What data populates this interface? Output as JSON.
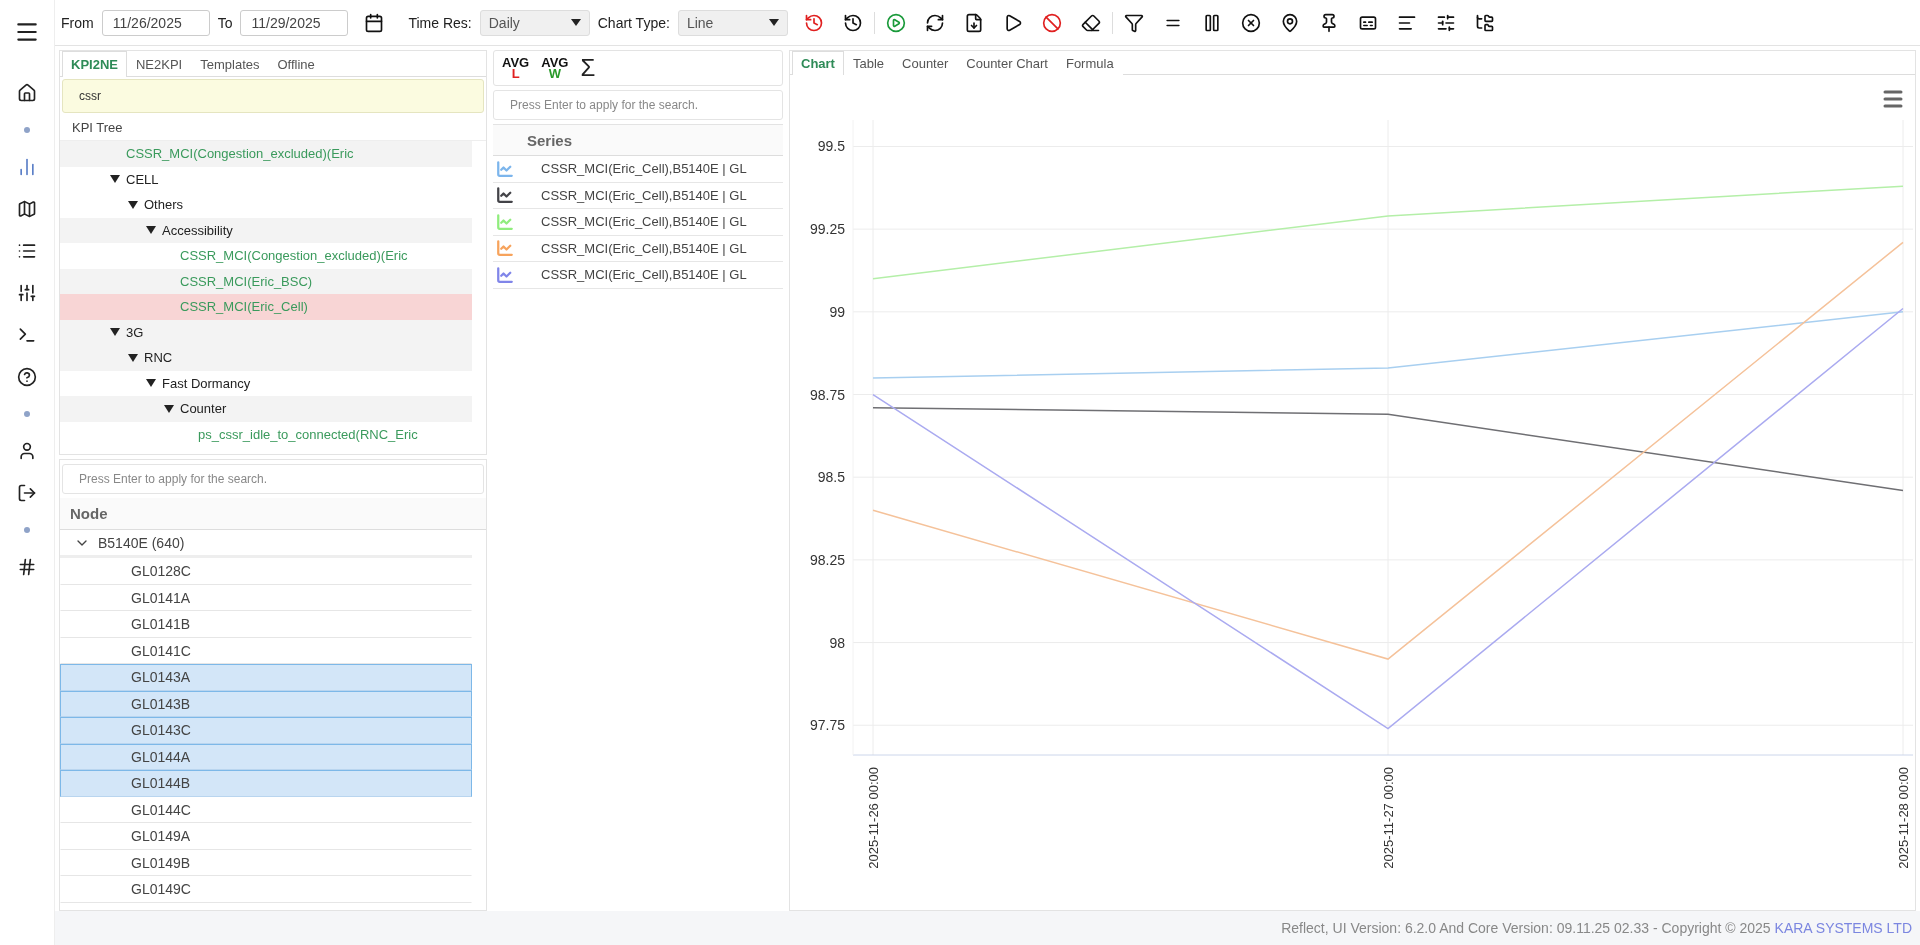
{
  "toolbar": {
    "from_label": "From",
    "from_value": "11/26/2025",
    "to_label": "To",
    "to_value": "11/29/2025",
    "time_res_label": "Time Res:",
    "time_res_value": "Daily",
    "chart_type_label": "Chart Type:",
    "chart_type_value": "Line"
  },
  "left_tabs": [
    {
      "label": "KPI2NE",
      "selected": true
    },
    {
      "label": "NE2KPI",
      "selected": false
    },
    {
      "label": "Templates",
      "selected": false
    },
    {
      "label": "Offline",
      "selected": false
    }
  ],
  "kpi_search": {
    "value": "cssr"
  },
  "kpi_tree": {
    "header": "KPI Tree",
    "items": [
      {
        "label": "CSSR_MCI(Congestion_excluded)(Eric",
        "kind": "kpi",
        "selected": false
      },
      {
        "label": "CELL",
        "kind": "folder",
        "expanded": true,
        "children": [
          {
            "label": "Others",
            "kind": "folder",
            "expanded": true,
            "children": [
              {
                "label": "Accessibility",
                "kind": "folder",
                "expanded": true,
                "children": [
                  {
                    "label": "CSSR_MCI(Congestion_excluded)(Eric",
                    "kind": "kpi",
                    "selected": false
                  },
                  {
                    "label": "CSSR_MCI(Eric_BSC)",
                    "kind": "kpi",
                    "selected": false
                  },
                  {
                    "label": "CSSR_MCI(Eric_Cell)",
                    "kind": "kpi",
                    "selected": true
                  }
                ]
              }
            ]
          }
        ]
      },
      {
        "label": "3G",
        "kind": "folder",
        "expanded": true,
        "children": [
          {
            "label": "RNC",
            "kind": "folder",
            "expanded": true,
            "children": [
              {
                "label": "Fast Dormancy",
                "kind": "folder",
                "expanded": true,
                "children": [
                  {
                    "label": "Counter",
                    "kind": "folder",
                    "expanded": true,
                    "children": [
                      {
                        "label": "ps_cssr_idle_to_connected(RNC_Eric",
                        "kind": "kpi",
                        "selected": false
                      }
                    ]
                  }
                ]
              }
            ]
          }
        ]
      }
    ]
  },
  "node_search": {
    "placeholder": "Press Enter to apply for the search."
  },
  "node_table": {
    "header": "Node",
    "group": {
      "label": "B5140E (640)",
      "expanded": true
    },
    "rows": [
      {
        "label": "GL0128C",
        "selected": false
      },
      {
        "label": "GL0141A",
        "selected": false
      },
      {
        "label": "GL0141B",
        "selected": false
      },
      {
        "label": "GL0141C",
        "selected": false
      },
      {
        "label": "GL0143A",
        "selected": true
      },
      {
        "label": "GL0143B",
        "selected": true
      },
      {
        "label": "GL0143C",
        "selected": true
      },
      {
        "label": "GL0144A",
        "selected": true
      },
      {
        "label": "GL0144B",
        "selected": true
      },
      {
        "label": "GL0144C",
        "selected": false
      },
      {
        "label": "GL0149A",
        "selected": false
      },
      {
        "label": "GL0149B",
        "selected": false
      },
      {
        "label": "GL0149C",
        "selected": false
      }
    ]
  },
  "aggregate_buttons": [
    {
      "label": "AVG",
      "sub": "L",
      "color": "#e02020"
    },
    {
      "label": "AVG",
      "sub": "W",
      "color": "#2a9a2a"
    },
    {
      "label": "Σ"
    }
  ],
  "series_search": {
    "placeholder": "Press Enter to apply for the search."
  },
  "series_list": {
    "header": "Series",
    "rows": [
      {
        "label": "CSSR_MCI(Eric_Cell),B5140E | GL",
        "color": "#7cb5ec"
      },
      {
        "label": "CSSR_MCI(Eric_Cell),B5140E | GL",
        "color": "#434348"
      },
      {
        "label": "CSSR_MCI(Eric_Cell),B5140E | GL",
        "color": "#90ed7d"
      },
      {
        "label": "CSSR_MCI(Eric_Cell),B5140E | GL",
        "color": "#f7a35c"
      },
      {
        "label": "CSSR_MCI(Eric_Cell),B5140E | GL",
        "color": "#8085e9"
      }
    ]
  },
  "view_tabs": [
    {
      "label": "Chart",
      "selected": true
    },
    {
      "label": "Table",
      "selected": false
    },
    {
      "label": "Counter",
      "selected": false
    },
    {
      "label": "Counter Chart",
      "selected": false
    },
    {
      "label": "Formula",
      "selected": false
    }
  ],
  "chart": {
    "chart_data": {
      "type": "line",
      "categories": [
        "2025-11-26 00:00",
        "2025-11-27 00:00",
        "2025-11-28 00:00"
      ],
      "grid": true,
      "ylim": [
        97.66,
        99.58
      ],
      "yticks": [
        {
          "value": 97.75,
          "label": "97.75"
        },
        {
          "value": 98,
          "label": "98"
        },
        {
          "value": 98.25,
          "label": "98.25"
        },
        {
          "value": 98.5,
          "label": "98.5"
        },
        {
          "value": 98.75,
          "label": "98.75"
        },
        {
          "value": 99,
          "label": "99"
        },
        {
          "value": 99.25,
          "label": "99.25"
        },
        {
          "value": 99.5,
          "label": "99.5"
        }
      ],
      "series": [
        {
          "color": "#a8cff0",
          "values": [
            98.8,
            98.83,
            99.0
          ]
        },
        {
          "color": "#6f6f73",
          "values": [
            98.71,
            98.69,
            98.46
          ]
        },
        {
          "color": "#b4efa8",
          "values": [
            99.1,
            99.29,
            99.38
          ]
        },
        {
          "color": "#f5c29a",
          "values": [
            98.4,
            97.95,
            99.21
          ]
        },
        {
          "color": "#aaaaf0",
          "values": [
            98.75,
            97.74,
            99.01
          ]
        }
      ]
    }
  },
  "footer": {
    "text": "Reflect, UI Version: 6.2.0 And Core Version: 09.11.25 02.33 - Copyright © 2025",
    "link": "KARA SYSTEMS LTD"
  }
}
